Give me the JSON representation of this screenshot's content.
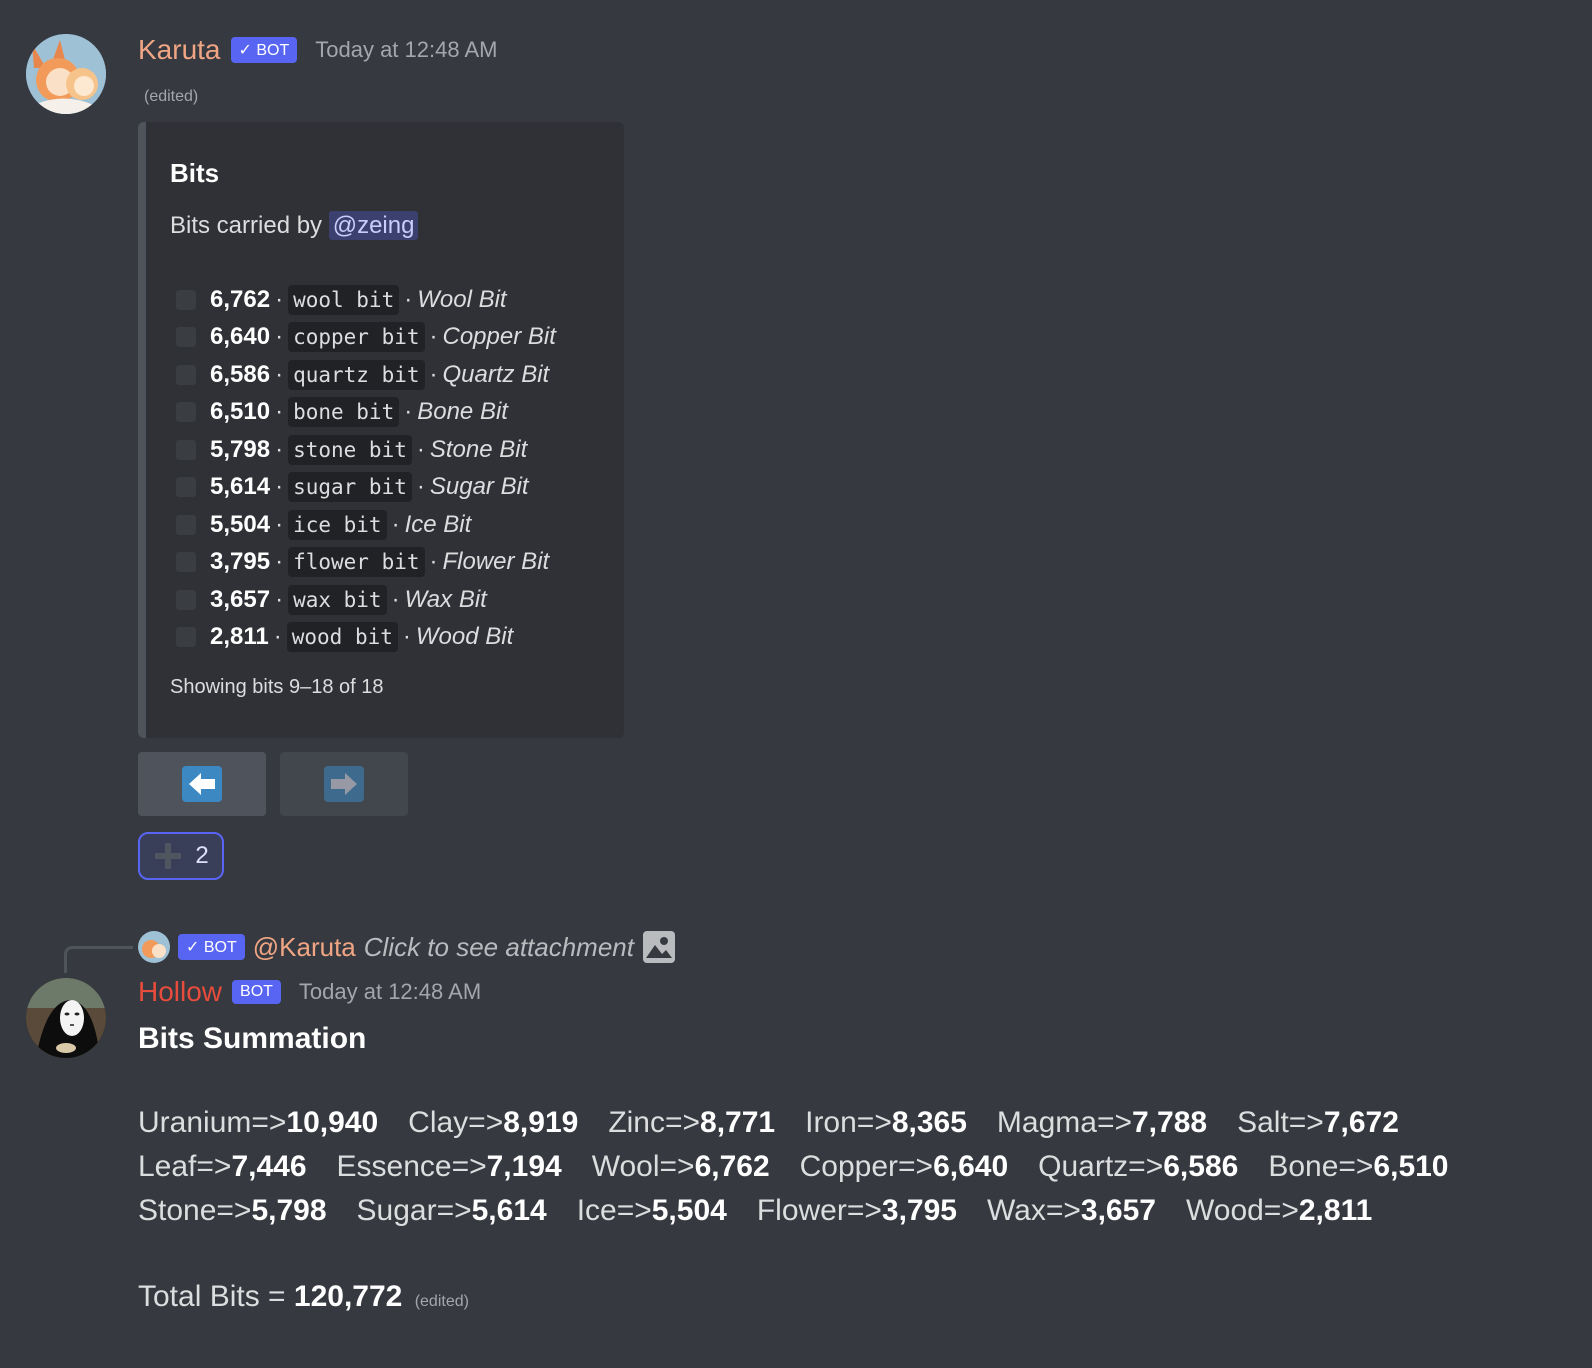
{
  "message1": {
    "author": "Karuta",
    "bot_tag": "✓ BOT",
    "timestamp": "Today at 12:48 AM",
    "edited": "(edited)",
    "embed": {
      "title": "Bits",
      "desc_prefix": "Bits carried by ",
      "mention": "@zeing",
      "bits": [
        {
          "count": "6,762",
          "code": "wool bit",
          "name": "Wool Bit"
        },
        {
          "count": "6,640",
          "code": "copper bit",
          "name": "Copper Bit"
        },
        {
          "count": "6,586",
          "code": "quartz bit",
          "name": "Quartz Bit"
        },
        {
          "count": "6,510",
          "code": "bone bit",
          "name": "Bone Bit"
        },
        {
          "count": "5,798",
          "code": "stone bit",
          "name": "Stone Bit"
        },
        {
          "count": "5,614",
          "code": "sugar bit",
          "name": "Sugar Bit"
        },
        {
          "count": "5,504",
          "code": "ice bit",
          "name": "Ice Bit"
        },
        {
          "count": "3,795",
          "code": "flower bit",
          "name": "Flower Bit"
        },
        {
          "count": "3,657",
          "code": "wax bit",
          "name": "Wax Bit"
        },
        {
          "count": "2,811",
          "code": "wood bit",
          "name": "Wood Bit"
        }
      ],
      "footer": "Showing bits 9–18 of 18"
    },
    "reaction": {
      "emoji": "plus",
      "count": "2"
    }
  },
  "reply": {
    "bot_tag": "✓ BOT",
    "mention": "@Karuta",
    "text": "Click to see attachment"
  },
  "message2": {
    "author": "Hollow",
    "bot_tag": "BOT",
    "timestamp": "Today at 12:48 AM",
    "title": "Bits Summation",
    "rows": [
      [
        {
          "k": "Uranium=>",
          "v": "10,940"
        },
        {
          "k": "Clay=>",
          "v": "8,919"
        },
        {
          "k": "Zinc=>",
          "v": "8,771"
        },
        {
          "k": "Iron=>",
          "v": "8,365"
        },
        {
          "k": "Magma=>",
          "v": "7,788"
        },
        {
          "k": "Salt=>",
          "v": "7,672"
        }
      ],
      [
        {
          "k": "Leaf=>",
          "v": "7,446"
        },
        {
          "k": "Essence=>",
          "v": "7,194"
        },
        {
          "k": "Wool=>",
          "v": "6,762"
        },
        {
          "k": "Copper=>",
          "v": "6,640"
        },
        {
          "k": "Quartz=>",
          "v": "6,586"
        },
        {
          "k": "Bone=>",
          "v": "6,510"
        }
      ],
      [
        {
          "k": "Stone=>",
          "v": "5,798"
        },
        {
          "k": "Sugar=>",
          "v": "5,614"
        },
        {
          "k": "Ice=>",
          "v": "5,504"
        },
        {
          "k": "Flower=>",
          "v": "3,795"
        },
        {
          "k": "Wax=>",
          "v": "3,657"
        },
        {
          "k": "Wood=>",
          "v": "2,811"
        }
      ]
    ],
    "total_label": "Total Bits = ",
    "total_value": "120,772",
    "edited": "(edited)"
  },
  "colors": {
    "karuta": "#f0a584",
    "hollow": "#e74c3c",
    "blurple": "#5865f2"
  }
}
